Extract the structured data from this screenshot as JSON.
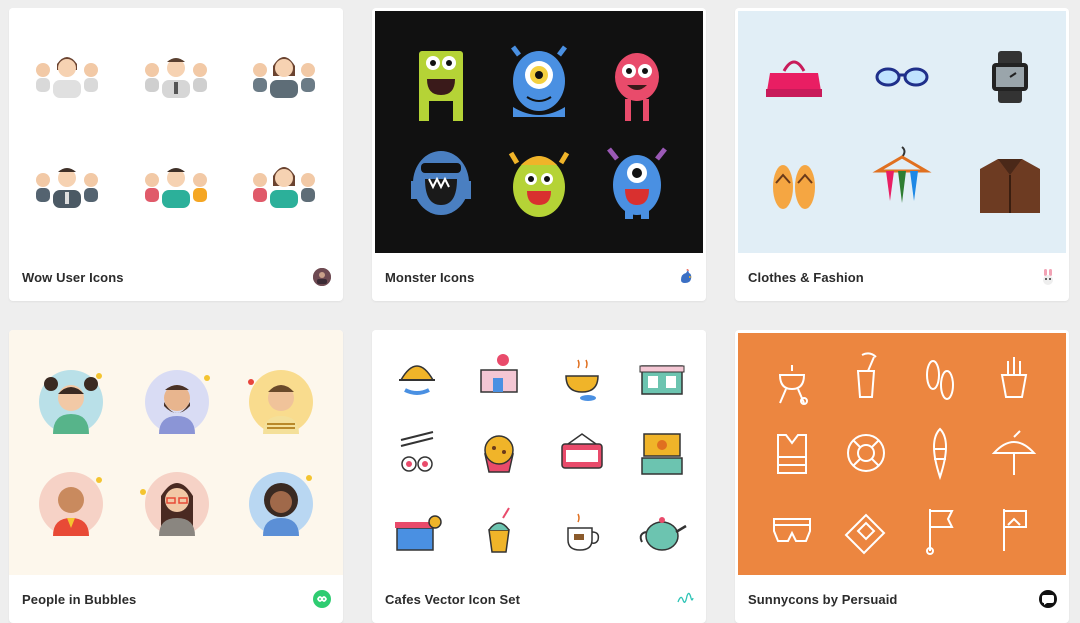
{
  "cards": [
    {
      "title": "Wow User Icons",
      "preview_bg": "#ffffff",
      "author_icon": "avatar-photo-icon"
    },
    {
      "title": "Monster Icons",
      "preview_bg": "#111111",
      "author_icon": "rooster-avatar-icon"
    },
    {
      "title": "Clothes & Fashion",
      "preview_bg": "#e1eef6",
      "author_icon": "rabbit-avatar-icon"
    },
    {
      "title": "People in Bubbles",
      "preview_bg": "#fdf7ec",
      "author_icon": "infinity-green-icon"
    },
    {
      "title": "Cafes Vector Icon Set",
      "preview_bg": "#ffffff",
      "author_icon": "signature-logo-icon"
    },
    {
      "title": "Sunnycons by Persuaid",
      "preview_bg": "#ec8640",
      "author_icon": "chat-bubble-black-icon"
    }
  ]
}
